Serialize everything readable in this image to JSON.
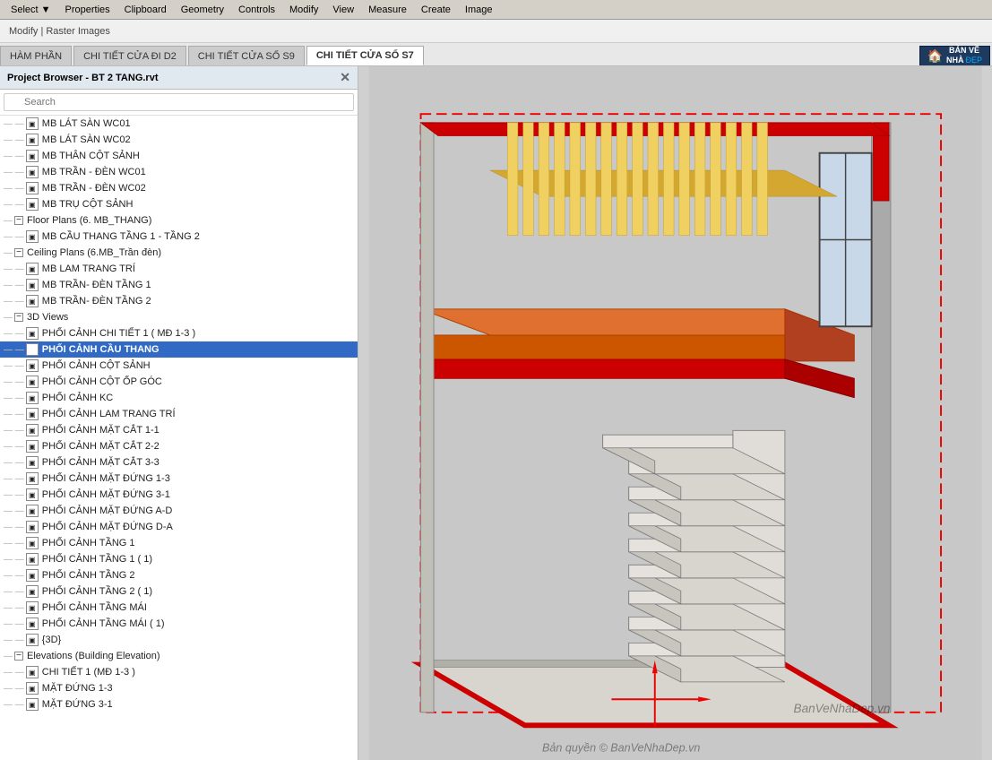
{
  "menubar": {
    "items": [
      "Select ▼",
      "Properties",
      "Clipboard",
      "Geometry",
      "Controls",
      "Modify",
      "View",
      "Measure",
      "Create",
      "Image"
    ]
  },
  "ribbon": {
    "text": "Modify | Raster Images"
  },
  "tabs": [
    {
      "label": "HÀM PHẦN",
      "active": false
    },
    {
      "label": "CHI TIẾT CỬA ĐI D2",
      "active": false
    },
    {
      "label": "CHI TIẾT CỬA SỔ S9",
      "active": false
    },
    {
      "label": "CHI TIẾT CỬA SỔ S7",
      "active": false
    }
  ],
  "sidebar": {
    "title": "Project Browser - BT 2 TANG.rvt",
    "search_placeholder": "Search",
    "tree": [
      {
        "indent": 2,
        "type": "leaf",
        "label": "MB LÁT SÀN WC01"
      },
      {
        "indent": 2,
        "type": "leaf",
        "label": "MB LÁT SÀN WC02"
      },
      {
        "indent": 2,
        "type": "leaf",
        "label": "MB THÂN CỘT SẢNH"
      },
      {
        "indent": 2,
        "type": "leaf",
        "label": "MB TRẦN - ĐÈN WC01"
      },
      {
        "indent": 2,
        "type": "leaf",
        "label": "MB TRẦN - ĐÈN WC02"
      },
      {
        "indent": 2,
        "type": "leaf",
        "label": "MB TRỤ CỘT SẢNH"
      },
      {
        "indent": 1,
        "type": "group",
        "label": "Floor Plans (6. MB_THANG)"
      },
      {
        "indent": 2,
        "type": "leaf",
        "label": "MB CẦU THANG TẦNG 1 - TẦNG 2"
      },
      {
        "indent": 1,
        "type": "group",
        "label": "Ceiling Plans (6.MB_Trần đèn)"
      },
      {
        "indent": 2,
        "type": "leaf",
        "label": "MB LAM TRANG TRÍ"
      },
      {
        "indent": 2,
        "type": "leaf",
        "label": "MB TRẦN- ĐÈN TẦNG 1"
      },
      {
        "indent": 2,
        "type": "leaf",
        "label": "MB TRẦN- ĐÈN TẦNG 2"
      },
      {
        "indent": 1,
        "type": "group",
        "label": "3D Views"
      },
      {
        "indent": 2,
        "type": "leaf",
        "label": "PHỐI CẢNH CHI TIẾT 1 ( MĐ 1-3 )"
      },
      {
        "indent": 2,
        "type": "leaf",
        "label": "PHỐI CẢNH CẦU THANG",
        "selected": true
      },
      {
        "indent": 2,
        "type": "leaf",
        "label": "PHỐI CẢNH CỘT SẢNH"
      },
      {
        "indent": 2,
        "type": "leaf",
        "label": "PHỐI CẢNH CỘT ỐP GÓC"
      },
      {
        "indent": 2,
        "type": "leaf",
        "label": "PHỐI CẢNH KC"
      },
      {
        "indent": 2,
        "type": "leaf",
        "label": "PHỐI CẢNH LAM TRANG TRÍ"
      },
      {
        "indent": 2,
        "type": "leaf",
        "label": "PHỐI CẢNH MẶT CẮT 1-1"
      },
      {
        "indent": 2,
        "type": "leaf",
        "label": "PHỐI CẢNH MẶT CẮT 2-2"
      },
      {
        "indent": 2,
        "type": "leaf",
        "label": "PHỐI CẢNH MẶT CẮT 3-3"
      },
      {
        "indent": 2,
        "type": "leaf",
        "label": "PHỐI CẢNH MẶT ĐỨNG 1-3"
      },
      {
        "indent": 2,
        "type": "leaf",
        "label": "PHỐI CẢNH MẶT ĐỨNG 3-1"
      },
      {
        "indent": 2,
        "type": "leaf",
        "label": "PHỐI CẢNH MẶT ĐỨNG A-D"
      },
      {
        "indent": 2,
        "type": "leaf",
        "label": "PHỐI CẢNH MẶT ĐỨNG D-A"
      },
      {
        "indent": 2,
        "type": "leaf",
        "label": "PHỐI CẢNH TẦNG 1"
      },
      {
        "indent": 2,
        "type": "leaf",
        "label": "PHỐI CẢNH TẦNG 1 ( 1)"
      },
      {
        "indent": 2,
        "type": "leaf",
        "label": "PHỐI CẢNH TẦNG 2"
      },
      {
        "indent": 2,
        "type": "leaf",
        "label": "PHỐI CẢNH TẦNG 2 ( 1)"
      },
      {
        "indent": 2,
        "type": "leaf",
        "label": "PHỐI CẢNH TẦNG MÁI"
      },
      {
        "indent": 2,
        "type": "leaf",
        "label": "PHỐI CẢNH TẦNG MÁI ( 1)"
      },
      {
        "indent": 2,
        "type": "leaf",
        "label": "{3D}"
      },
      {
        "indent": 1,
        "type": "group",
        "label": "Elevations (Building Elevation)"
      },
      {
        "indent": 2,
        "type": "leaf",
        "label": "CHI TIẾT 1 (MĐ 1-3 )"
      },
      {
        "indent": 2,
        "type": "leaf",
        "label": "MẶT ĐỨNG 1-3"
      },
      {
        "indent": 2,
        "type": "leaf",
        "label": "MẶT ĐỨNG 3-1"
      }
    ]
  },
  "watermark": {
    "text1": "BanVeNhaDep.vn",
    "text2": "Bản quyền © BanVeNhaDep.vn"
  },
  "logo": {
    "line1": "BẢN VẼ",
    "line2": "NHÀ",
    "line3": "ĐẸP"
  }
}
